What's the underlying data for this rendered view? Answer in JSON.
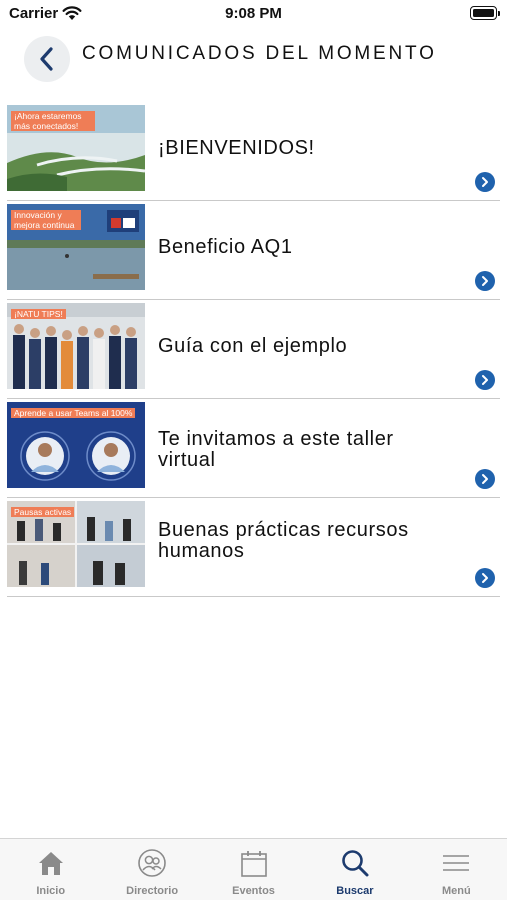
{
  "status_bar": {
    "carrier": "Carrier",
    "time": "9:08 PM"
  },
  "header": {
    "title": "COMUNICADOS DEL MOMENTO",
    "back_icon": "chevron-left-icon"
  },
  "colors": {
    "accent": "#1f62ad",
    "tag": "#ef7d56",
    "active_tab": "#1d3b6e",
    "inactive_tab": "#8a8a8a"
  },
  "items": [
    {
      "title": "¡BIENVENIDOS!",
      "thumb_text": "¡Ahora estaremos más conectados!"
    },
    {
      "title": "Beneficio AQ1",
      "thumb_text": "Innovación y mejora continua"
    },
    {
      "title": "Guía con el ejemplo",
      "thumb_text": "¡NATU TIPS!"
    },
    {
      "title": "Te invitamos a este taller virtual",
      "thumb_text": "Aprende a usar Teams al 100%"
    },
    {
      "title": "Buenas prácticas recursos humanos",
      "thumb_text": "Pausas activas"
    }
  ],
  "tabs": [
    {
      "label": "Inicio",
      "icon": "home-icon"
    },
    {
      "label": "Directorio",
      "icon": "people-icon"
    },
    {
      "label": "Eventos",
      "icon": "calendar-icon"
    },
    {
      "label": "Buscar",
      "icon": "search-icon",
      "active": true
    },
    {
      "label": "Menú",
      "icon": "menu-icon"
    }
  ]
}
